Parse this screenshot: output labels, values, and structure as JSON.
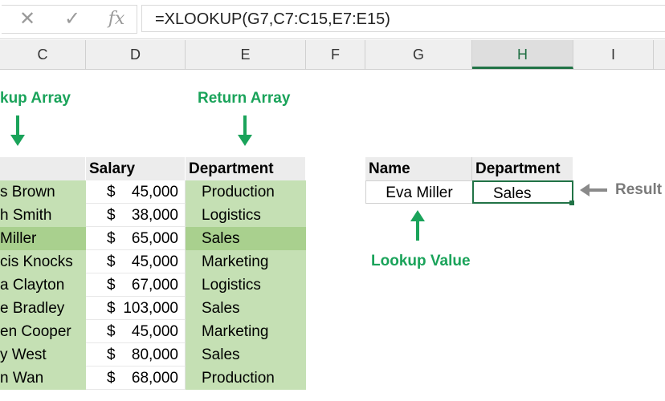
{
  "formula_bar": {
    "cancel_icon": "✕",
    "enter_icon": "✓",
    "function_icon": "fx",
    "formula": "=XLOOKUP(G7,C7:C15,E7:E15)"
  },
  "columns": [
    "C",
    "D",
    "E",
    "F",
    "G",
    "H",
    "I"
  ],
  "active_column": "H",
  "annotations": {
    "lookup_array": "kup Array",
    "return_array": "Return Array",
    "lookup_value": "Lookup Value",
    "result": "Result"
  },
  "table": {
    "headers": {
      "salary": "Salary",
      "department": "Department"
    },
    "rows": [
      {
        "name": "s Brown",
        "currency": "$",
        "salary": "45,000",
        "department": "Production"
      },
      {
        "name": "h Smith",
        "currency": "$",
        "salary": "38,000",
        "department": "Logistics"
      },
      {
        "name": "Miller",
        "currency": "$",
        "salary": "65,000",
        "department": "Sales",
        "highlighted": true
      },
      {
        "name": "cis Knocks",
        "currency": "$",
        "salary": "45,000",
        "department": "Marketing"
      },
      {
        "name": "a Clayton",
        "currency": "$",
        "salary": "67,000",
        "department": "Logistics"
      },
      {
        "name": "e Bradley",
        "currency": "$",
        "salary": "103,000",
        "department": "Sales"
      },
      {
        "name": "en Cooper",
        "currency": "$",
        "salary": "45,000",
        "department": "Marketing"
      },
      {
        "name": "y West",
        "currency": "$",
        "salary": "80,000",
        "department": "Sales"
      },
      {
        "name": "n Wan",
        "currency": "$",
        "salary": "68,000",
        "department": "Production"
      }
    ]
  },
  "lookup": {
    "name_header": "Name",
    "department_header": "Department",
    "name_value": "Eva Miller",
    "result_value": "Sales"
  },
  "colors": {
    "green_fill": "#c5e0b4",
    "green_highlight": "#a9d08e",
    "annotation_green": "#1aa35a",
    "selection_border": "#217346"
  }
}
